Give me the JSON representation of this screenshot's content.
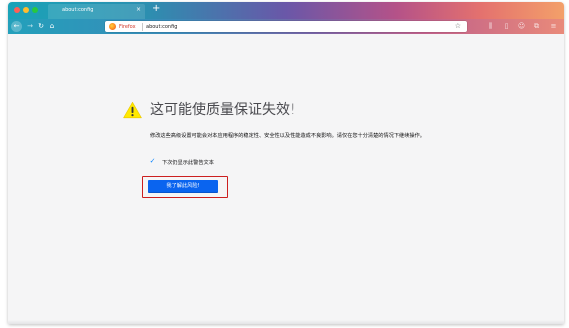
{
  "window": {
    "tab": {
      "title": "about:config",
      "close_glyph": "×"
    },
    "new_tab_glyph": "+",
    "nav": {
      "back_icon": "arrow-left-icon",
      "forward_icon": "arrow-right-icon",
      "reload_icon": "reload-icon",
      "home_icon": "home-icon",
      "back_glyph": "←",
      "forward_glyph": "→",
      "reload_glyph": "↻",
      "home_glyph": "⌂"
    },
    "urlbar": {
      "identity": "Firefox",
      "url": "about:config",
      "star_glyph": "☆"
    },
    "toolbar_icons": [
      {
        "name": "library-icon",
        "glyph": "⫼"
      },
      {
        "name": "sidebar-icon",
        "glyph": "▯"
      },
      {
        "name": "account-icon",
        "glyph": "☺"
      },
      {
        "name": "extension-icon",
        "glyph": "⧉"
      },
      {
        "name": "menu-icon",
        "glyph": "≡"
      }
    ]
  },
  "page": {
    "title": "这可能使质量保证失效!",
    "description": "修改这些高级设置可能会对本应用程序的稳定性、安全性以及性能造成不良影响。请仅在您十分清楚的情况下继续操作。",
    "checkbox": {
      "checked": true,
      "glyph": "✓",
      "label": "下次仍显示此警告文本"
    },
    "accept_button": "我了解此风险!"
  },
  "colors": {
    "accent": "#0a64ef",
    "warning": "#ffe900",
    "highlight": "#cc1f1f"
  }
}
